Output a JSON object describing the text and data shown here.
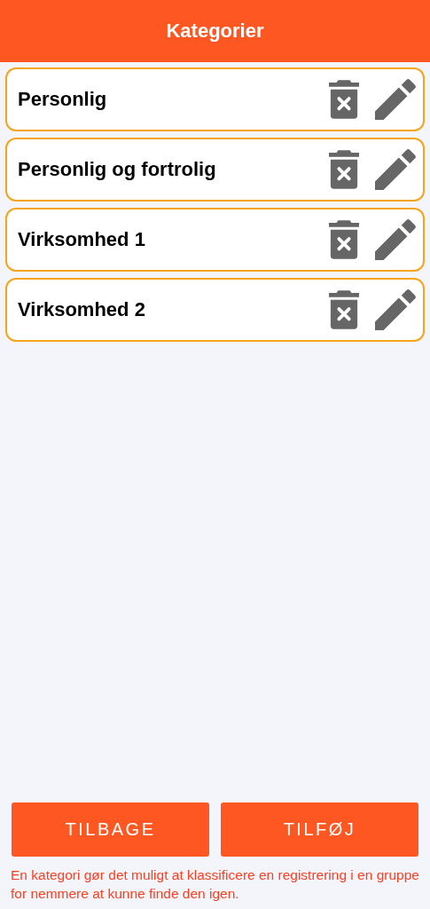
{
  "header": {
    "title": "Kategorier"
  },
  "categories": [
    {
      "name": "Personlig"
    },
    {
      "name": "Personlig og fortrolig"
    },
    {
      "name": "Virksomhed 1"
    },
    {
      "name": "Virksomhed 2"
    }
  ],
  "buttons": [
    {
      "label": "TILBAGE"
    },
    {
      "label": "TILFØJ"
    }
  ],
  "footer_note": "En kategori gør det muligt at klassificere en registrering i en gruppe for nemmere at kunne finde den igen."
}
